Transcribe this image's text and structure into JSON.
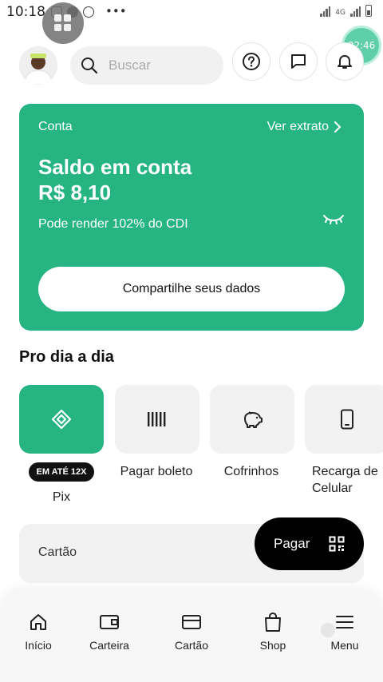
{
  "status_bar": {
    "time": "10:18",
    "network": "4G",
    "more": "•••"
  },
  "overlay": {
    "timer": "02:46"
  },
  "header": {
    "search_placeholder": "Buscar"
  },
  "balance_card": {
    "label": "Conta",
    "link": "Ver extrato",
    "title": "Saldo em conta",
    "value": "R$ 8,10",
    "subtitle": "Pode render 102% do CDI",
    "share_button": "Compartilhe seus dados"
  },
  "section_title": "Pro dia a dia",
  "shortcuts": [
    {
      "label": "Pix",
      "badge": "EM ATÉ 12X",
      "icon": "pix-icon"
    },
    {
      "label": "Pagar boleto",
      "icon": "barcode-icon"
    },
    {
      "label": "Cofrinhos",
      "icon": "piggy-bank-icon"
    },
    {
      "label": "Recarga de Celular",
      "icon": "phone-icon"
    }
  ],
  "card_row": {
    "label": "Cartão"
  },
  "pay_button": {
    "label": "Pagar"
  },
  "bottom_nav": {
    "items": [
      {
        "label": "Início",
        "icon": "home-icon"
      },
      {
        "label": "Carteira",
        "icon": "wallet-icon"
      },
      {
        "label": "Cartão",
        "icon": "card-icon"
      },
      {
        "label": "Shop",
        "icon": "shopping-bag-icon"
      },
      {
        "label": "Menu",
        "icon": "menu-icon"
      }
    ]
  },
  "colors": {
    "brand": "#26b483",
    "pay_button": "#000000",
    "surface": "#f2f2f2"
  }
}
